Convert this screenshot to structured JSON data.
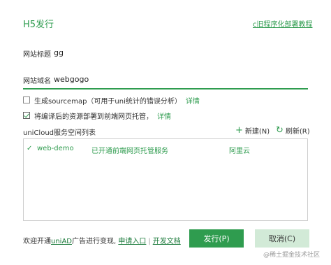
{
  "dialog": {
    "title": "H5发行",
    "top_link": "c旧程序化部署教程"
  },
  "fields": {
    "site_title_label": "网站标题",
    "site_title_value": "gg",
    "site_domain_label": "网站域名",
    "site_domain_value": "webgogo"
  },
  "options": {
    "sourcemap_label": "生成sourcemap（可用于uni统计的错误分析）",
    "sourcemap_link": "详情",
    "sourcemap_checked": false,
    "deploy_label": "将编译后的资源部署到前端网页托管，",
    "deploy_link": "详情",
    "deploy_checked": true
  },
  "unicloud": {
    "section_label": "uniCloud服务空间列表",
    "new_label": "新建(N)",
    "refresh_label": "刷新(R)",
    "items": [
      {
        "check": "✓",
        "name": "web-demo",
        "status": "已开通前端网页托管服务",
        "provider": "阿里云"
      }
    ]
  },
  "footer": {
    "prefix": "欢迎开通",
    "uniad": "uniAD",
    "middle": "广告进行变现,",
    "apply_link": "申请入口",
    "separator": "|",
    "docs_link": "开发文档"
  },
  "buttons": {
    "publish": "发行(P)",
    "cancel": "取消(C)"
  },
  "watermark": "@稀土掘金技术社区",
  "colors": {
    "accent": "#2f9c4f",
    "cancel_bg": "#d2ead7"
  },
  "icons": {
    "new": "plus-icon",
    "refresh": "refresh-icon",
    "item_check": "check-icon"
  }
}
